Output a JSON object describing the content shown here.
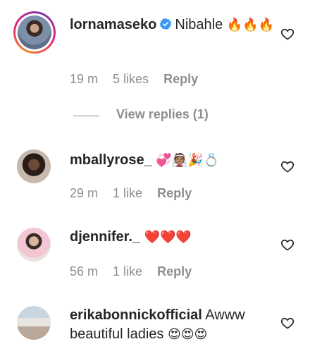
{
  "comments": [
    {
      "username": "lornamaseko",
      "verified": true,
      "text": "Nibahle",
      "emojis": "🔥🔥🔥",
      "time": "19 m",
      "likes": "5 likes",
      "reply": "Reply"
    },
    {
      "username": "mballyrose_",
      "verified": false,
      "text": "",
      "emojis": "💞👰🏽🎉💍",
      "time": "29 m",
      "likes": "1 like",
      "reply": "Reply"
    },
    {
      "username": "djennifer._",
      "verified": false,
      "text": "",
      "emojis": "❤️❤️❤️",
      "time": "56 m",
      "likes": "1 like",
      "reply": "Reply"
    },
    {
      "username": "erikabonnickofficial",
      "verified": false,
      "text": "Awww beautiful ladies",
      "emojis": "😍😍😍"
    }
  ],
  "view_replies": "View replies (1)",
  "icons": {
    "heart": "heart-outline-icon",
    "verified": "verified-badge-icon"
  },
  "colors": {
    "text": "#262626",
    "muted": "#8e8e8e",
    "verified": "#3897f0"
  }
}
